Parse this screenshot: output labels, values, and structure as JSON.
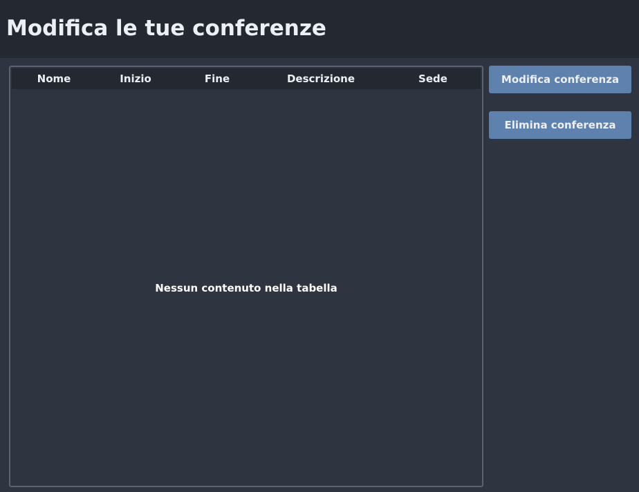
{
  "header": {
    "title": "Modifica le tue conferenze"
  },
  "table": {
    "columns": [
      "Nome",
      "Inizio",
      "Fine",
      "Descrizione",
      "Sede"
    ],
    "rows": [],
    "empty_message": "Nessun contenuto nella tabella"
  },
  "actions": {
    "edit_label": "Modifica conferenza",
    "delete_label": "Elimina conferenza"
  },
  "colors": {
    "background": "#2e3440",
    "header_background": "#242831",
    "button_accent": "#5f81ad",
    "text": "#eceff4"
  }
}
